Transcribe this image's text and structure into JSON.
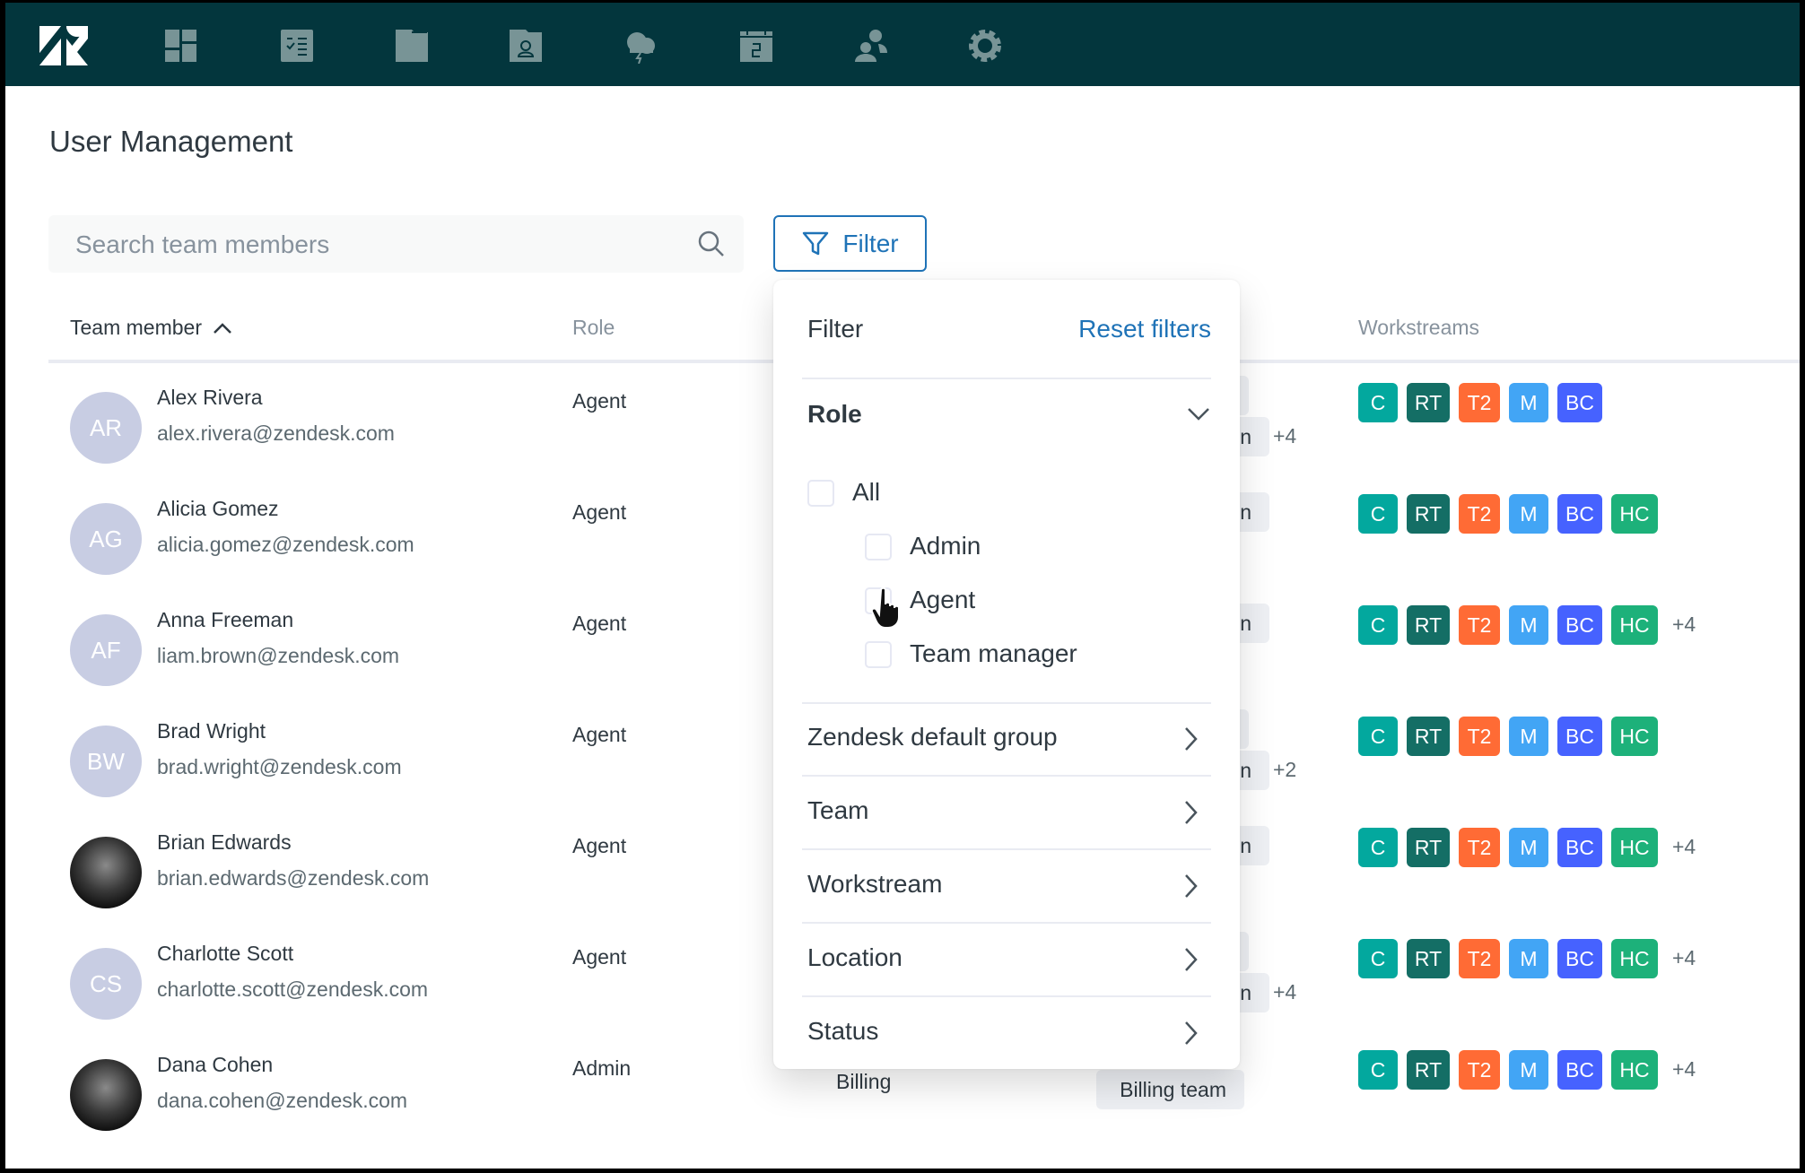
{
  "nav": {
    "logo": "zendesk-logo",
    "icons": [
      "dashboard-icon",
      "tickets-icon",
      "folder-icon",
      "contacts-icon",
      "weather-icon",
      "calendar-icon",
      "users-icon",
      "settings-icon"
    ]
  },
  "page": {
    "title": "User Management"
  },
  "search": {
    "placeholder": "Search team members",
    "value": ""
  },
  "filter_button": {
    "label": "Filter"
  },
  "table": {
    "headers": {
      "member": "Team member",
      "role": "Role",
      "workstreams": "Workstreams"
    },
    "sort": "ascending",
    "rows": [
      {
        "initials": "AR",
        "name": "Alex Rivera",
        "email": "alex.rivera@zendesk.com",
        "role": "Agent",
        "photo": false,
        "team_pills": [
          "",
          "n"
        ],
        "team_more": "+4",
        "workstreams": [
          "C",
          "RT",
          "T2",
          "M",
          "BC"
        ],
        "ws_more": ""
      },
      {
        "initials": "AG",
        "name": "Alicia Gomez",
        "email": "alicia.gomez@zendesk.com",
        "role": "Agent",
        "photo": false,
        "team_pills": [
          "n"
        ],
        "team_more": "",
        "workstreams": [
          "C",
          "RT",
          "T2",
          "M",
          "BC",
          "HC"
        ],
        "ws_more": ""
      },
      {
        "initials": "AF",
        "name": "Anna Freeman",
        "email": "liam.brown@zendesk.com",
        "role": "Agent",
        "photo": false,
        "team_pills": [
          "n"
        ],
        "team_more": "",
        "workstreams": [
          "C",
          "RT",
          "T2",
          "M",
          "BC",
          "HC"
        ],
        "ws_more": "+4"
      },
      {
        "initials": "BW",
        "name": "Brad Wright",
        "email": "brad.wright@zendesk.com",
        "role": "Agent",
        "photo": false,
        "team_pills": [
          "",
          "n"
        ],
        "team_more": "+2",
        "workstreams": [
          "C",
          "RT",
          "T2",
          "M",
          "BC",
          "HC"
        ],
        "ws_more": ""
      },
      {
        "initials": "",
        "name": "Brian Edwards",
        "email": "brian.edwards@zendesk.com",
        "role": "Agent",
        "photo": true,
        "team_pills": [
          "n"
        ],
        "team_more": "",
        "workstreams": [
          "C",
          "RT",
          "T2",
          "M",
          "BC",
          "HC"
        ],
        "ws_more": "+4"
      },
      {
        "initials": "CS",
        "name": "Charlotte Scott",
        "email": "charlotte.scott@zendesk.com",
        "role": "Agent",
        "photo": false,
        "team_pills": [
          "",
          "n"
        ],
        "team_more": "+4",
        "workstreams": [
          "C",
          "RT",
          "T2",
          "M",
          "BC",
          "HC"
        ],
        "ws_more": "+4"
      },
      {
        "initials": "",
        "name": "Dana Cohen",
        "email": "dana.cohen@zendesk.com",
        "role": "Admin",
        "photo": true,
        "group": "Billing",
        "team_pills": [
          "Billing team"
        ],
        "team_more": "",
        "workstreams": [
          "C",
          "RT",
          "T2",
          "M",
          "BC",
          "HC"
        ],
        "ws_more": "+4"
      }
    ]
  },
  "workstream_colors": {
    "C": "#03a89e",
    "RT": "#146e65",
    "T2": "#ff6b35",
    "M": "#42a5f5",
    "BC": "#4662ff",
    "HC": "#1db17a"
  },
  "filter_panel": {
    "title": "Filter",
    "reset_label": "Reset filters",
    "role_section": {
      "label": "Role",
      "expanded": true,
      "options": [
        {
          "label": "All",
          "checked": false
        },
        {
          "label": "Admin",
          "checked": false
        },
        {
          "label": "Agent",
          "checked": false
        },
        {
          "label": "Team manager",
          "checked": false
        }
      ]
    },
    "sections": [
      "Zendesk default group",
      "Team",
      "Workstream",
      "Location",
      "Status"
    ]
  },
  "colors": {
    "nav_bg": "#03363d",
    "accent": "#1f73b7"
  }
}
